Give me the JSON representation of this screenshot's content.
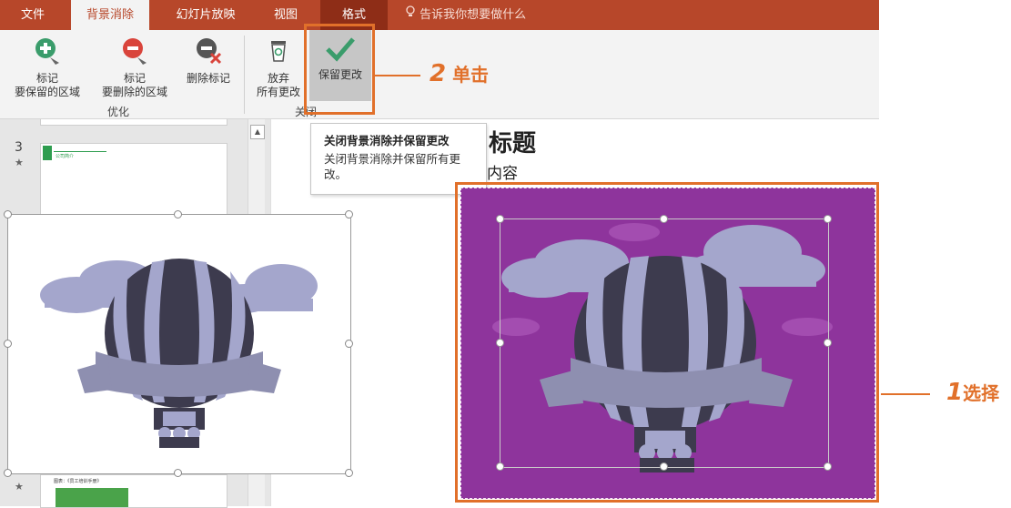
{
  "tabs": [
    {
      "label": "文件"
    },
    {
      "label": "背景消除"
    },
    {
      "label": "幻灯片放映"
    },
    {
      "label": "视图"
    },
    {
      "label": "格式"
    }
  ],
  "tell_me": "告诉我你想要做什么",
  "ribbon": {
    "mark_keep": {
      "line1": "标记",
      "line2": "要保留的区域"
    },
    "mark_remove": {
      "line1": "标记",
      "line2": "要删除的区域"
    },
    "delete_mark": "删除标记",
    "refine_group": "优化",
    "discard": {
      "line1": "放弃",
      "line2": "所有更改"
    },
    "keep_changes": "保留更改",
    "close_group": "关闭"
  },
  "tooltip": {
    "title": "关闭背景消除并保留更改",
    "body": "关闭背景消除并保留所有更改。"
  },
  "callouts": {
    "step2": {
      "num": "2",
      "text": "单击"
    },
    "step1": {
      "num": "1",
      "text": "选择"
    }
  },
  "slides": {
    "slide3_number": "3",
    "star": "★",
    "slide3_mini_title": "公司简介",
    "slide_bottom_mini": "图表：《员工培训手册》"
  },
  "slide": {
    "title_partial": "标题",
    "content_partial": "内容"
  },
  "colors": {
    "tab_bar": "#b7472a",
    "accent_orange": "#e1702a",
    "selected_bg": "#8e349c"
  }
}
